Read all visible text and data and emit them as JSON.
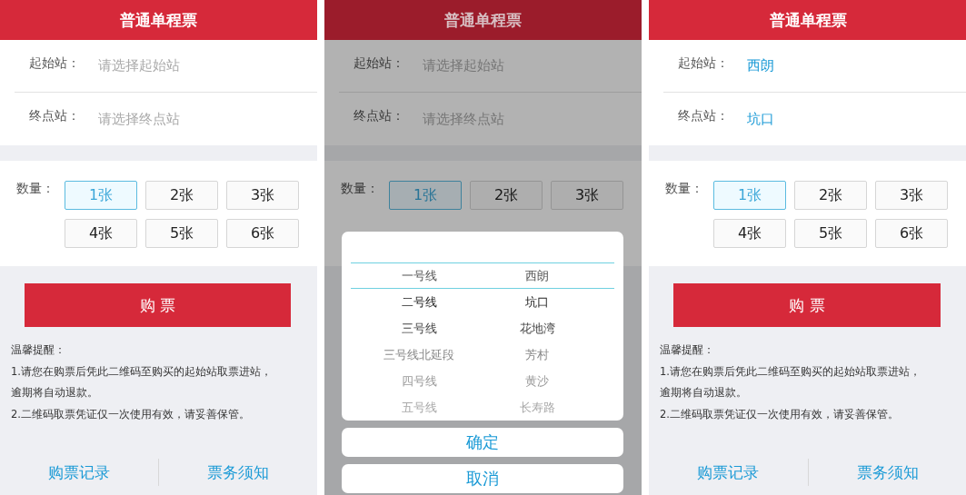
{
  "screens": [
    {
      "title": "普通单程票",
      "dimmed": false,
      "fields": [
        {
          "label": "起始站：",
          "placeholder": "请选择起始站"
        },
        {
          "label": "终点站：",
          "placeholder": "请选择终点站"
        }
      ],
      "quantity": {
        "label": "数量：",
        "options": [
          {
            "label": "1张",
            "selected": true
          },
          {
            "label": "2张",
            "selected": false
          },
          {
            "label": "3张",
            "selected": false
          },
          {
            "label": "4张",
            "selected": false
          },
          {
            "label": "5张",
            "selected": false
          },
          {
            "label": "6张",
            "selected": false
          }
        ]
      },
      "buy_button": "购 票",
      "notice": {
        "title": "温馨提醒：",
        "lines": [
          "1.请您在购票后凭此二维码至购买的起始站取票进站，",
          "逾期将自动退款。",
          "2.二维码取票凭证仅一次使用有效，请妥善保管。"
        ]
      },
      "footer_links": [
        "购票记录",
        "票务须知"
      ]
    },
    {
      "title": "普通单程票",
      "dimmed": true,
      "fields": [
        {
          "label": "起始站：",
          "placeholder": "请选择起始站"
        },
        {
          "label": "终点站：",
          "placeholder": "请选择终点站"
        }
      ],
      "quantity": {
        "label": "数量：",
        "options": [
          {
            "label": "1张",
            "selected": true
          },
          {
            "label": "2张",
            "selected": false
          },
          {
            "label": "3张",
            "selected": false
          }
        ]
      },
      "picker": {
        "rows": [
          {
            "line": "一号线",
            "station": "西朗",
            "selected": true
          },
          {
            "line": "二号线",
            "station": "坑口",
            "selected": false
          },
          {
            "line": "三号线",
            "station": "花地湾",
            "selected": false
          },
          {
            "line": "三号线北延段",
            "station": "芳村",
            "selected": false
          },
          {
            "line": "四号线",
            "station": "黄沙",
            "selected": false
          },
          {
            "line": "五号线",
            "station": "长寿路",
            "selected": false
          }
        ],
        "buttons": [
          "确定",
          "取消"
        ]
      }
    },
    {
      "title": "普通单程票",
      "dimmed": false,
      "fields": [
        {
          "label": "起始站：",
          "value": "西朗"
        },
        {
          "label": "终点站：",
          "value": "坑口"
        }
      ],
      "quantity": {
        "label": "数量：",
        "options": [
          {
            "label": "1张",
            "selected": true
          },
          {
            "label": "2张",
            "selected": false
          },
          {
            "label": "3张",
            "selected": false
          },
          {
            "label": "4张",
            "selected": false
          },
          {
            "label": "5张",
            "selected": false
          },
          {
            "label": "6张",
            "selected": false
          }
        ]
      },
      "buy_button": "购 票",
      "notice": {
        "title": "温馨提醒：",
        "lines": [
          "1.请您在购票后凭此二维码至购买的起始站取票进站，",
          "逾期将自动退款。",
          "2.二维码取票凭证仅一次使用有效，请妥善保管。"
        ]
      },
      "footer_links": [
        "购票记录",
        "票务须知"
      ]
    }
  ]
}
